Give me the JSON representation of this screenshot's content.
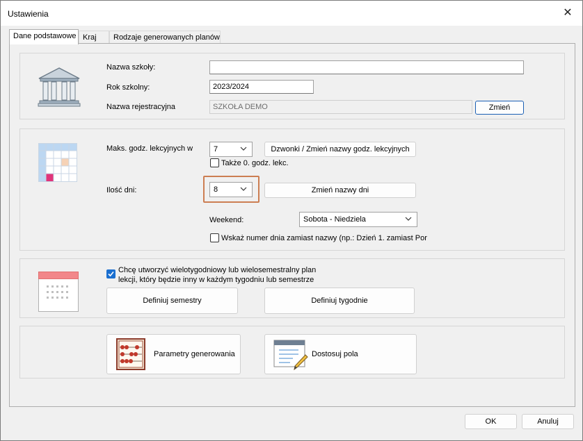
{
  "window": {
    "title": "Ustawienia",
    "close_glyph": "✕"
  },
  "tabs": [
    {
      "label": "Dane podstawowe",
      "active": true
    },
    {
      "label": "Kraj",
      "active": false
    },
    {
      "label": "Rodzaje generowanych planów",
      "active": false
    }
  ],
  "school": {
    "name_label": "Nazwa szkoły:",
    "name_value": "",
    "year_label": "Rok szkolny:",
    "year_value": "2023/2024",
    "reg_label": "Nazwa rejestracyjna",
    "reg_value": "SZKOŁA DEMO",
    "change_button": "Zmień",
    "icon": "school-building-icon"
  },
  "lessons": {
    "max_label": "Maks. godz. lekcyjnych w",
    "max_value": "7",
    "bells_button": "Dzwonki / Zmień nazwy godz. lekcyjnych",
    "zero_hour_label": "Także 0. godz. lekc.",
    "zero_hour_checked": false,
    "days_label": "Ilość dni:",
    "days_value": "8",
    "rename_days_button": "Zmień nazwy dni",
    "weekend_label": "Weekend:",
    "weekend_value": "Sobota - Niedziela",
    "show_number_label": "Wskaż numer dnia zamiast nazwy (np.: Dzień 1. zamiast Por",
    "show_number_checked": false,
    "icon": "timetable-grid-icon"
  },
  "semesters": {
    "multi_label_line1": "Chcę utworzyć wielotygodniowy lub wielosemestralny plan",
    "multi_label_line2": "lekcji, który będzie inny w każdym tygodniu lub semestrze",
    "multi_checked": true,
    "define_semesters": "Definiuj semestry",
    "define_weeks": "Definiuj tygodnie",
    "icon": "calendar-icon"
  },
  "generation": {
    "params_button": "Parametry generowania",
    "fields_button": "Dostosuj pola",
    "params_icon": "abacus-icon",
    "fields_icon": "edit-form-icon"
  },
  "footer": {
    "ok": "OK",
    "cancel": "Anuluj"
  },
  "colors": {
    "accent": "#1a6fd0",
    "highlight": "#cc7e52",
    "grid_blue": "#bcd7f2",
    "grid_pink": "#e0347a",
    "grid_peach": "#f6d2b6"
  }
}
